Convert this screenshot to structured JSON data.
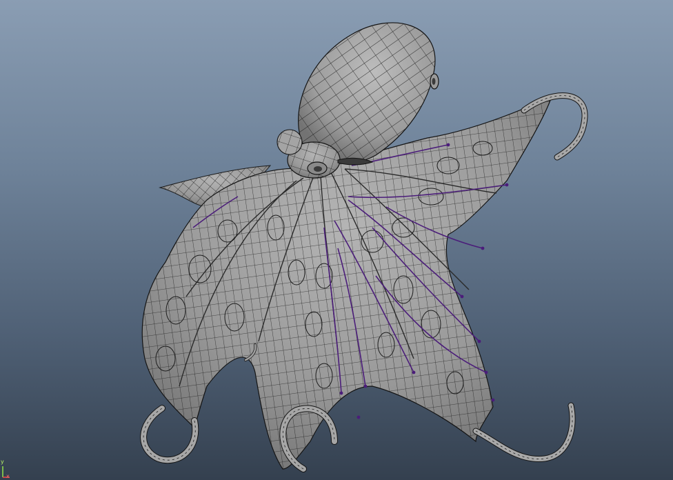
{
  "viewport": {
    "background_top": "#8a9db3",
    "background_bottom": "#34404f",
    "mesh_fill": "#9c9c9c",
    "mesh_shade": "#6f6f6f",
    "wire_color": "#151515",
    "edge_select_color": "#4b1d7a"
  },
  "axis_gizmo": {
    "x_label": "x",
    "y_label": "y",
    "x_color": "#ff4a4a",
    "y_color": "#9cef4a"
  },
  "model": {
    "icon": "octopus-mesh-icon"
  }
}
